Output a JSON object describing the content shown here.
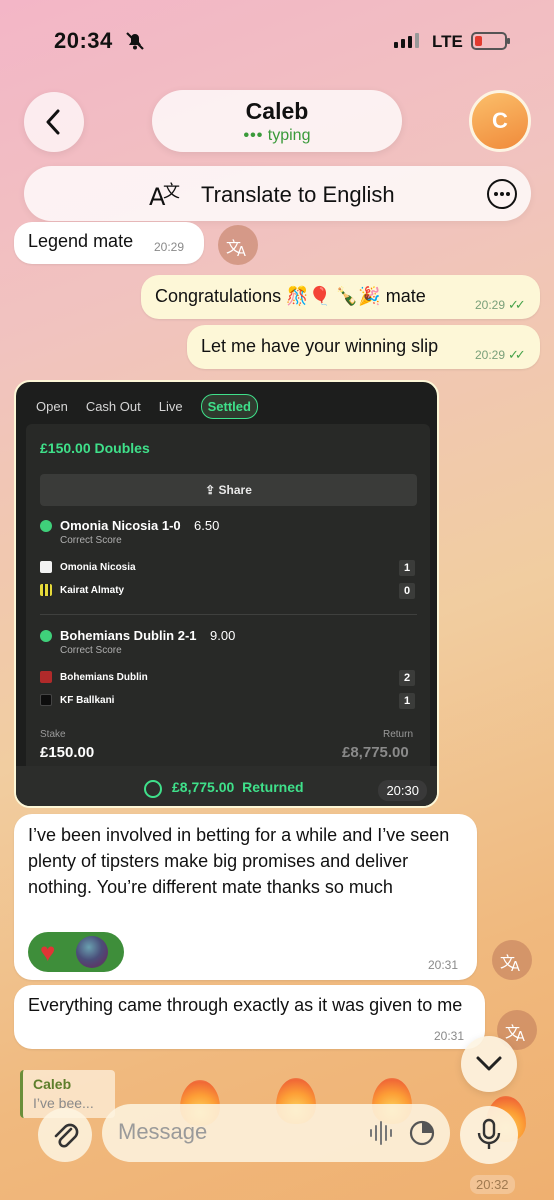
{
  "status_bar": {
    "time": "20:34",
    "network": "LTE"
  },
  "header": {
    "name": "Caleb",
    "status_dots": "•••",
    "status": "typing",
    "avatar_initial": "C"
  },
  "translate_bar": {
    "label": "Translate to English"
  },
  "messages": [
    {
      "text": "Legend mate",
      "time": "20:29"
    },
    {
      "text": "Congratulations 🎊🎈 🍾🎉 mate",
      "time": "20:29",
      "ticks": "✓✓"
    },
    {
      "text": "Let me have your winning slip",
      "time": "20:29",
      "ticks": "✓✓"
    },
    {
      "text": "I’ve been involved in betting for a while and I’ve seen plenty of tipsters make big promises and deliver nothing. You’re different mate thanks so much",
      "time": "20:31",
      "reaction_heart": "♥"
    },
    {
      "text": "Everything came through exactly as it was given to me",
      "time": "20:31"
    }
  ],
  "bet_slip": {
    "tabs": [
      "Open",
      "Cash Out",
      "Live",
      "Settled"
    ],
    "title": "£150.00 Doubles",
    "share_label": "Share",
    "legs": [
      {
        "title": "Omonia Nicosia 1-0",
        "odds": "6.50",
        "market": "Correct Score",
        "teams": [
          {
            "name": "Omonia Nicosia",
            "score": "1"
          },
          {
            "name": "Kairat Almaty",
            "score": "0"
          }
        ]
      },
      {
        "title": "Bohemians Dublin 2-1",
        "odds": "9.00",
        "market": "Correct Score",
        "teams": [
          {
            "name": "Bohemians Dublin",
            "score": "2"
          },
          {
            "name": "KF Ballkani",
            "score": "1"
          }
        ]
      }
    ],
    "stake_label": "Stake",
    "stake_value": "£150.00",
    "return_label": "Return",
    "return_value": "£8,775.00",
    "returned_amount": "£8,775.00",
    "returned_label": "Returned",
    "time": "20:30"
  },
  "reply_preview": {
    "name": "Caleb",
    "text": "I’ve bee..."
  },
  "composer": {
    "placeholder": "Message"
  },
  "bottom_time": "20:32",
  "colors": {
    "accent_green": "#3fe08a",
    "bubble_out": "#fdf7d7",
    "bubble_in": "#ffffff"
  },
  "icons": [
    "back-chevron-icon",
    "translate-icon",
    "more-icon",
    "attach-icon",
    "waveform-icon",
    "sticker-icon",
    "mic-icon",
    "chevron-down-icon"
  ]
}
